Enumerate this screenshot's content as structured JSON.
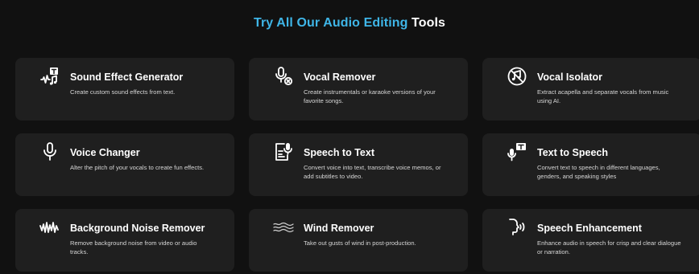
{
  "header": {
    "title_accent": "Try All Our Audio",
    "title_accent2": "Editing",
    "title_plain": "Tools",
    "accent_color": "#3fb6e8"
  },
  "tools": [
    {
      "title": "Sound Effect Generator",
      "description": "Create custom sound effects from text.",
      "icon": "sound-effect-icon"
    },
    {
      "title": "Vocal Remover",
      "description": "Create instrumentals or karaoke versions of your favorite songs.",
      "icon": "mic-remove-icon"
    },
    {
      "title": "Vocal Isolator",
      "description": "Extract acapella and separate vocals from music using AI.",
      "icon": "no-music-icon"
    },
    {
      "title": "Voice Changer",
      "description": "Alter the pitch of your vocals to create fun effects.",
      "icon": "microphone-icon"
    },
    {
      "title": "Speech to Text",
      "description": "Convert voice into text, transcribe voice memos, or add subtitles to video.",
      "icon": "speech-to-text-icon"
    },
    {
      "title": "Text to Speech",
      "description": "Convert text to speech in different languages, genders, and speaking styles",
      "icon": "text-to-speech-icon"
    },
    {
      "title": "Background Noise Remover",
      "description": "Remove background noise from video or audio tracks.",
      "icon": "waveform-icon"
    },
    {
      "title": "Wind Remover",
      "description": "Take out gusts of wind in post-production.",
      "icon": "wind-icon"
    },
    {
      "title": "Speech Enhancement",
      "description": "Enhance audio in speech for crisp and clear dialogue or narration.",
      "icon": "speaking-head-icon"
    }
  ]
}
